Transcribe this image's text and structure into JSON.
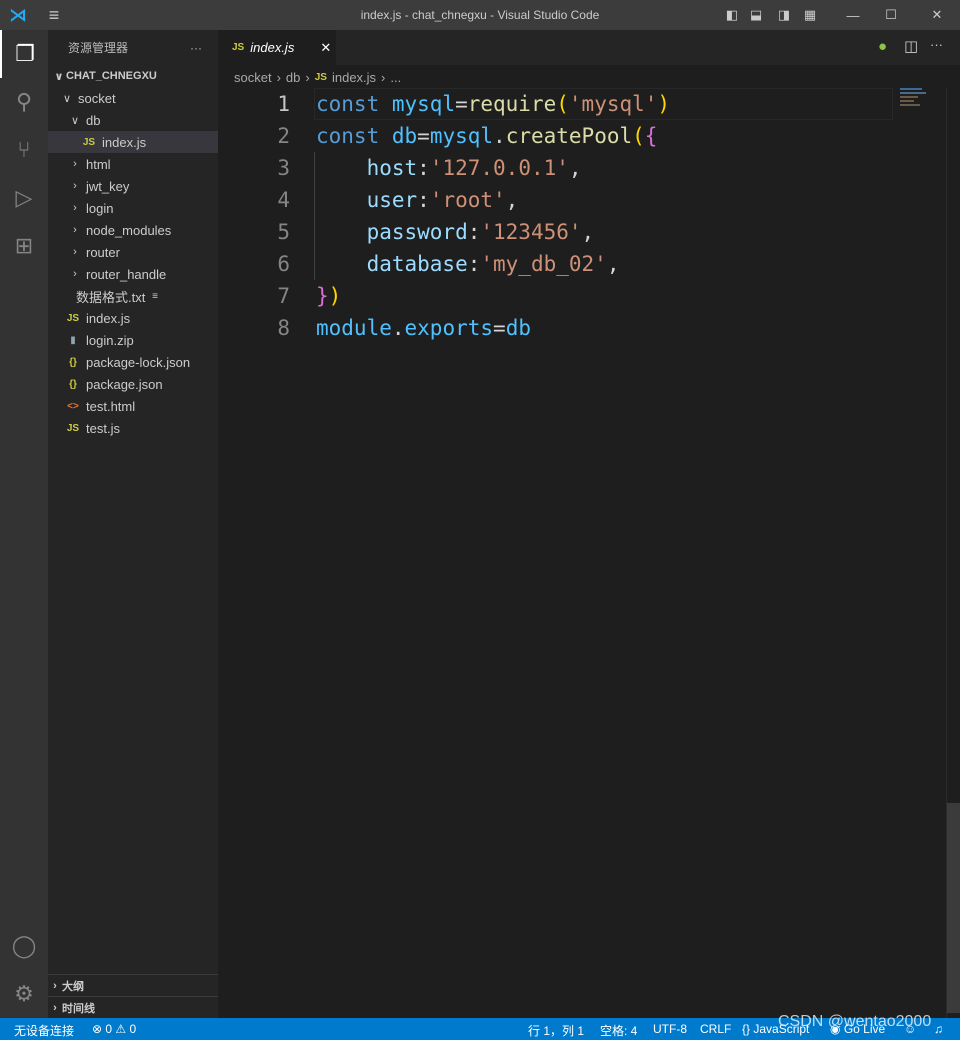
{
  "window": {
    "title": "index.js - chat_chnegxu - Visual Studio Code"
  },
  "sidebar": {
    "header": "资源管理器",
    "more": "···",
    "root": "CHAT_CHNEGXU",
    "items": [
      {
        "label": "socket",
        "type": "folder",
        "open": true,
        "depth": 1
      },
      {
        "label": "db",
        "type": "folder",
        "open": true,
        "depth": 2
      },
      {
        "label": "index.js",
        "type": "js",
        "depth": 3,
        "selected": true
      },
      {
        "label": "html",
        "type": "folder",
        "depth": 2
      },
      {
        "label": "jwt_key",
        "type": "folder",
        "depth": 2
      },
      {
        "label": "login",
        "type": "folder",
        "depth": 2
      },
      {
        "label": "node_modules",
        "type": "folder",
        "depth": 2
      },
      {
        "label": "router",
        "type": "folder",
        "depth": 2
      },
      {
        "label": "router_handle",
        "type": "folder",
        "depth": 2
      },
      {
        "label": "数据格式.txt",
        "type": "txt",
        "depth": 2
      },
      {
        "label": "index.js",
        "type": "js",
        "depth": 1
      },
      {
        "label": "login.zip",
        "type": "zip",
        "depth": 1
      },
      {
        "label": "package-lock.json",
        "type": "json",
        "depth": 1
      },
      {
        "label": "package.json",
        "type": "json",
        "depth": 1
      },
      {
        "label": "test.html",
        "type": "html",
        "depth": 1
      },
      {
        "label": "test.js",
        "type": "js",
        "depth": 1
      }
    ],
    "outline": "大纲",
    "timeline": "时间线"
  },
  "editor": {
    "tab": {
      "icon": "JS",
      "label": "index.js",
      "close": "✕"
    },
    "breadcrumb": [
      "socket",
      "db",
      "index.js",
      "..."
    ],
    "lines": [
      [
        [
          "const ",
          "kw"
        ],
        [
          "mysql",
          "var"
        ],
        [
          "=",
          "op"
        ],
        [
          "require",
          "fn"
        ],
        [
          "(",
          "b1"
        ],
        [
          "'mysql'",
          "str"
        ],
        [
          ")",
          "b1"
        ]
      ],
      [
        [
          "const ",
          "kw"
        ],
        [
          "db",
          "var"
        ],
        [
          "=",
          "op"
        ],
        [
          "mysql",
          "var"
        ],
        [
          ".",
          "op"
        ],
        [
          "createPool",
          "fn"
        ],
        [
          "(",
          "b1"
        ],
        [
          "{",
          "b2"
        ]
      ],
      [
        [
          "    host",
          "prop"
        ],
        [
          ":",
          "op"
        ],
        [
          "'127.0.0.1'",
          "str"
        ],
        [
          ",",
          "op"
        ]
      ],
      [
        [
          "    user",
          "prop"
        ],
        [
          ":",
          "op"
        ],
        [
          "'root'",
          "str"
        ],
        [
          ",",
          "op"
        ]
      ],
      [
        [
          "    password",
          "prop"
        ],
        [
          ":",
          "op"
        ],
        [
          "'123456'",
          "str"
        ],
        [
          ",",
          "op"
        ]
      ],
      [
        [
          "    database",
          "prop"
        ],
        [
          ":",
          "op"
        ],
        [
          "'my_db_02'",
          "str"
        ],
        [
          ",",
          "op"
        ]
      ],
      [
        [
          "}",
          "b2"
        ],
        [
          ")",
          "b1"
        ]
      ],
      [
        [
          "module",
          "var"
        ],
        [
          ".",
          "op"
        ],
        [
          "exports",
          "var"
        ],
        [
          "=",
          "op"
        ],
        [
          "db",
          "var"
        ]
      ]
    ]
  },
  "status": {
    "remote": "无设备连接",
    "errors": "0",
    "warnings": "0",
    "position": "行 1，列 1",
    "spaces": "空格: 4",
    "encoding": "UTF-8",
    "eol": "CRLF",
    "language": "JavaScript",
    "golive": "Go Live"
  },
  "watermark": "CSDN @wentao2000",
  "colors": {
    "statusbar": "#007acc",
    "activity": "#333333",
    "sidebar": "#252526",
    "editor": "#1e1e1e"
  }
}
